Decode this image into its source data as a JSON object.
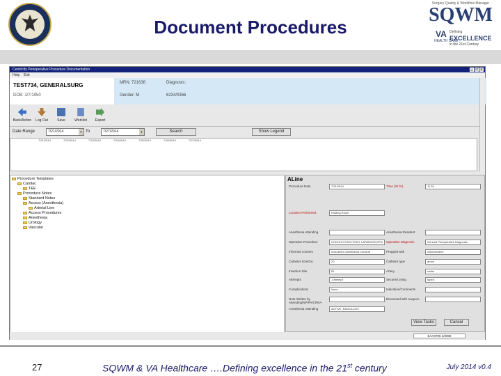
{
  "slide": {
    "title": "Document Procedures",
    "page_number": "27",
    "footer_pre": "SQWM & VA Healthcare ….Defining excellence in the 21",
    "footer_sup": "st",
    "footer_post": " century",
    "footer_date": "July 2014  v0.4"
  },
  "brand": {
    "tagline": "Surgery Quality & Workflow Manager",
    "logo": "SQWM",
    "va": "VA",
    "va_care": "HEALTH CARE",
    "defining": "Defining",
    "excellence": "EXCELLENCE",
    "century": "in the 21st Century"
  },
  "app": {
    "window_title": "Centricity Perioperative Procedure Documentation",
    "menu": [
      "Help",
      "Exit"
    ],
    "patient": {
      "name": "TEST734, GENERALSURG",
      "dob": "DOB: 1/7/1950",
      "mrn": "MRN: 721636",
      "gender": "Gender: M",
      "diagnosis_label": "Diagnosis:",
      "code": "6234/0366"
    },
    "toolbar": [
      {
        "label": "Back/Action",
        "icon": "back-arrow-icon"
      },
      {
        "label": "Log Out",
        "icon": "logout-icon"
      },
      {
        "label": "Save",
        "icon": "save-icon"
      },
      {
        "label": "Worklist",
        "icon": "worklist-icon"
      },
      {
        "label": "Export",
        "icon": "export-icon"
      }
    ],
    "date_range": {
      "label": "Date Range",
      "from": "7/21/2014",
      "to_label": "To",
      "to": "7/27/2014",
      "search_btn": "Search",
      "legend_btn": "Show Legend"
    },
    "timeline_dates": [
      "7/21/2014",
      "7/22/2014",
      "7/23/2014",
      "7/24/2014",
      "7/25/2014",
      "7/26/2014",
      "7/27/2014"
    ],
    "tree": [
      {
        "label": "Procedure Templates",
        "indent": 0
      },
      {
        "label": "Cardiac",
        "indent": 1
      },
      {
        "label": "TEE",
        "indent": 2
      },
      {
        "label": "Procedure Notes",
        "indent": 1
      },
      {
        "label": "Standard Notes",
        "indent": 2
      },
      {
        "label": "Access (Anesthesia)",
        "indent": 2
      },
      {
        "label": "Arterial Line",
        "indent": 3
      },
      {
        "label": "Access Procedures",
        "indent": 2
      },
      {
        "label": "Anesthesia",
        "indent": 2
      },
      {
        "label": "Urology",
        "indent": 2
      },
      {
        "label": "Vascular",
        "indent": 2
      }
    ],
    "form": {
      "title": "ALine",
      "fields": [
        {
          "label": "Procedure Date",
          "value": "7/21/2014",
          "req": false
        },
        {
          "label": "Time (24 hr)",
          "value": "11:26",
          "req": true
        },
        {
          "label": "Location Performed",
          "value": "Holding Room",
          "req": true
        },
        {
          "label": "Anesthesia Attending",
          "value": "",
          "req": false
        },
        {
          "label": "Anesthesia Resident",
          "value": "",
          "req": false
        },
        {
          "label": "Operative Procedure",
          "value": "CHOLECYSTECTOMY, LAPAROSCOPIC",
          "req": false
        },
        {
          "label": "Operative Diagnosis",
          "value": "General Perioperative Diagnosis",
          "req": true
        },
        {
          "label": "Informed consent",
          "value": "Included in Anesthesia Consent",
          "req": false
        },
        {
          "label": "Prepped with",
          "value": "chlorhexidine",
          "req": false
        },
        {
          "label": "Catheter Size/Ga",
          "value": "20",
          "req": false
        },
        {
          "label": "Catheter type",
          "value": "arrow",
          "req": false
        },
        {
          "label": "Insertion Site",
          "value": "Rt",
          "req": false
        },
        {
          "label": "Artery",
          "value": "radial",
          "req": false
        },
        {
          "label": "Attempts",
          "value": "1 attempt",
          "req": false
        },
        {
          "label": "Secured using",
          "value": "taped",
          "req": false
        },
        {
          "label": "Complications",
          "value": "None",
          "req": false
        },
        {
          "label": "Indication/Comments",
          "value": "",
          "req": false
        },
        {
          "label": "Note Written by Attending/NP/PA/CRNA",
          "value": "",
          "req": false
        },
        {
          "label": "Discussed with surgeon",
          "value": "",
          "req": false
        },
        {
          "label": "Anesthesia Attending",
          "value": "ACTIVE, RADIOLOGY",
          "req": false
        }
      ],
      "view_tasks_btn": "View Tasks",
      "cancel_btn": "Cancel"
    },
    "status": "EAA0799 4/2008"
  }
}
